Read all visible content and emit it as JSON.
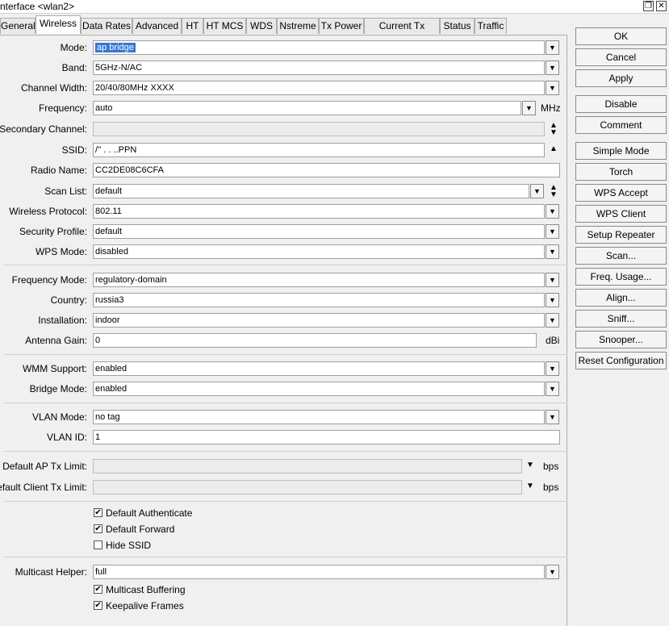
{
  "window": {
    "title": "nterface <wlan2>",
    "restore_glyph": "❐",
    "close_glyph": "✕"
  },
  "tabs": [
    "General",
    "Wireless",
    "Data Rates",
    "Advanced",
    "HT",
    "HT MCS",
    "WDS",
    "Nstreme",
    "Tx Power",
    "Current Tx Power",
    "Status",
    "Traffic"
  ],
  "active_tab": "Wireless",
  "fields": {
    "mode": {
      "label": "Mode:",
      "value": "ap bridge"
    },
    "band": {
      "label": "Band:",
      "value": "5GHz-N/AC"
    },
    "channel_width": {
      "label": "Channel Width:",
      "value": "20/40/80MHz XXXX"
    },
    "frequency": {
      "label": "Frequency:",
      "value": "auto",
      "unit": "MHz"
    },
    "secondary_channel": {
      "label": "Secondary Channel:",
      "value": ""
    },
    "ssid": {
      "label": "SSID:",
      "value": "/'' . . ..ΡΡΝ"
    },
    "radio_name": {
      "label": "Radio Name:",
      "value": "CC2DE08C6CFA"
    },
    "scan_list": {
      "label": "Scan List:",
      "value": "default"
    },
    "wireless_protocol": {
      "label": "Wireless Protocol:",
      "value": "802.11"
    },
    "security_profile": {
      "label": "Security Profile:",
      "value": "default"
    },
    "wps_mode": {
      "label": "WPS Mode:",
      "value": "disabled"
    },
    "frequency_mode": {
      "label": "Frequency Mode:",
      "value": "regulatory-domain"
    },
    "country": {
      "label": "Country:",
      "value": "russia3"
    },
    "installation": {
      "label": "Installation:",
      "value": "indoor"
    },
    "antenna_gain": {
      "label": "Antenna Gain:",
      "value": "0",
      "unit": "dBi"
    },
    "wmm_support": {
      "label": "WMM Support:",
      "value": "enabled"
    },
    "bridge_mode": {
      "label": "Bridge Mode:",
      "value": "enabled"
    },
    "vlan_mode": {
      "label": "VLAN Mode:",
      "value": "no tag"
    },
    "vlan_id": {
      "label": "VLAN ID:",
      "value": "1"
    },
    "default_ap_tx_limit": {
      "label": "Default AP Tx Limit:",
      "value": "",
      "unit": "bps"
    },
    "default_client_tx_limit": {
      "label": "Default Client Tx Limit:",
      "value": "",
      "unit": "bps"
    },
    "multicast_helper": {
      "label": "Multicast Helper:",
      "value": "full"
    }
  },
  "checkboxes": {
    "default_authenticate": {
      "label": "Default Authenticate",
      "checked": true
    },
    "default_forward": {
      "label": "Default Forward",
      "checked": true
    },
    "hide_ssid": {
      "label": "Hide SSID",
      "checked": false
    },
    "multicast_buffering": {
      "label": "Multicast Buffering",
      "checked": true
    },
    "keepalive_frames": {
      "label": "Keepalive Frames",
      "checked": true
    }
  },
  "glyphs": {
    "check": "✔",
    "dropdown": "▼",
    "down_arrow": "▼",
    "up_arrow": "▲",
    "updown_up": "▲",
    "updown_down": "▼"
  },
  "buttons": {
    "ok": "OK",
    "cancel": "Cancel",
    "apply": "Apply",
    "disable": "Disable",
    "comment": "Comment",
    "simple_mode": "Simple Mode",
    "torch": "Torch",
    "wps_accept": "WPS Accept",
    "wps_client": "WPS Client",
    "setup_repeater": "Setup Repeater",
    "scan": "Scan...",
    "freq_usage": "Freq. Usage...",
    "align": "Align...",
    "sniff": "Sniff...",
    "snooper": "Snooper...",
    "reset_configuration": "Reset Configuration"
  }
}
